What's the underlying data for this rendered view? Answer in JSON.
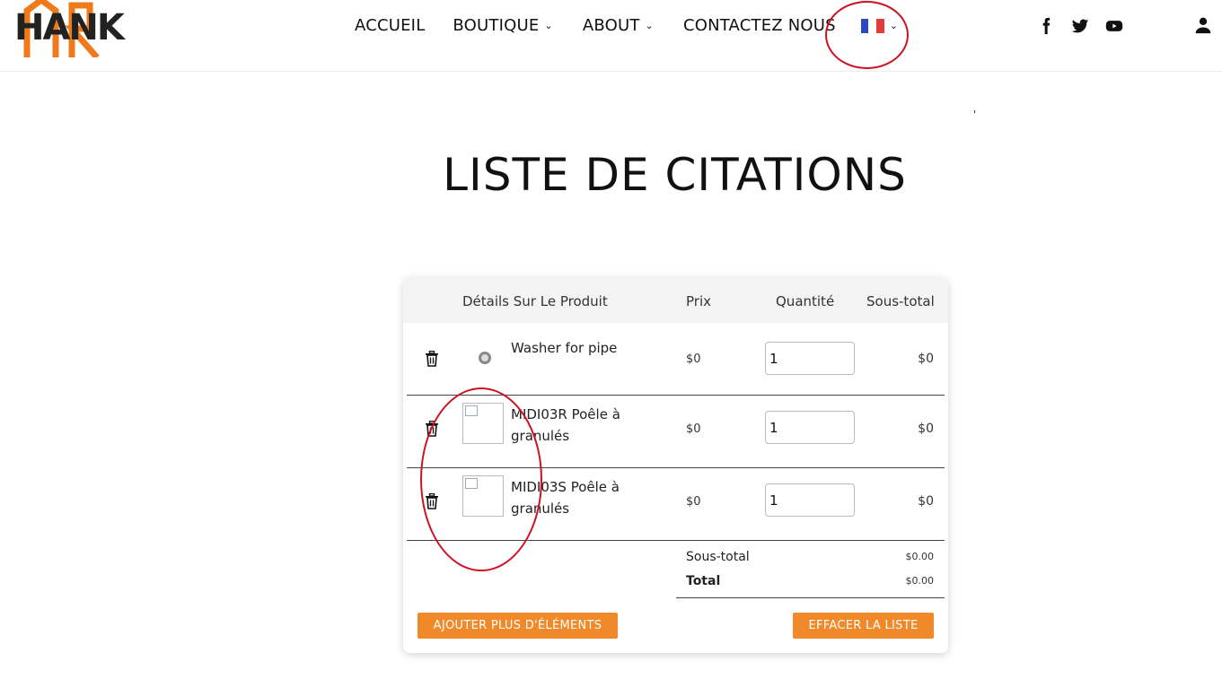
{
  "header": {
    "logo_text": "HANK",
    "nav": [
      {
        "label": "ACCUEIL"
      },
      {
        "label": "BOUTIQUE"
      },
      {
        "label": "ABOUT"
      },
      {
        "label": "CONTACTEZ NOUS"
      }
    ],
    "language_icon": "france-flag-icon",
    "social_icons": [
      "facebook-icon",
      "twitter-icon",
      "youtube-icon"
    ],
    "user_icon": "user-icon"
  },
  "page_title": "LISTE DE CITATIONS",
  "table": {
    "headers": {
      "details": "Détails Sur Le Produit",
      "price": "Prix",
      "qty": "Quantité",
      "subtotal": "Sous-total"
    },
    "rows": [
      {
        "name": "Washer for pipe",
        "price": "$0",
        "qty": "1",
        "subtotal": "$0"
      },
      {
        "name": "MIDI03R Poêle à granulés",
        "price": "$0",
        "qty": "1",
        "subtotal": "$0"
      },
      {
        "name": "MIDI03S Poêle à granulés",
        "price": "$0",
        "qty": "1",
        "subtotal": "$0"
      }
    ]
  },
  "totals": {
    "subtotal_label": "Sous-total",
    "subtotal_value": "$0.00",
    "total_label": "Total",
    "total_value": "$0.00"
  },
  "buttons": {
    "add_more": "AJOUTER PLUS D'ÉLÉMENTS",
    "clear": "EFFACER LA LISTE"
  },
  "colors": {
    "accent": "#f0892a",
    "annotation": "#cc1122",
    "logo_orange": "#f07a1a"
  }
}
